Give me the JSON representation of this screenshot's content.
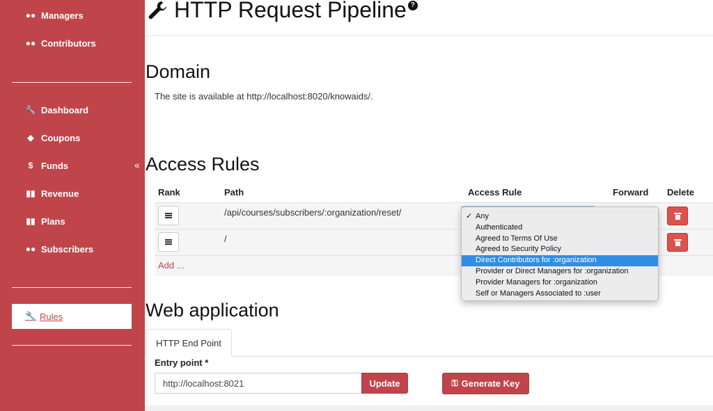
{
  "sidebar": {
    "top_items": [
      {
        "label": "Managers",
        "icon": "users-icon"
      },
      {
        "label": "Contributors",
        "icon": "users-icon"
      }
    ],
    "mid_items": [
      {
        "label": "Dashboard",
        "icon": "wrench-icon"
      },
      {
        "label": "Coupons",
        "icon": "tag-icon"
      },
      {
        "label": "Funds",
        "icon": "dollar-icon"
      },
      {
        "label": "Revenue",
        "icon": "bar-chart-icon"
      },
      {
        "label": "Plans",
        "icon": "bar-chart-icon"
      },
      {
        "label": "Subscribers",
        "icon": "users-icon"
      }
    ],
    "active_item": {
      "label": "Rules",
      "icon": "wrench-icon"
    },
    "collapse_glyph": "«"
  },
  "header": {
    "title": "HTTP Request Pipeline",
    "help_glyph": "?"
  },
  "domain": {
    "heading": "Domain",
    "text": "The site is available at http://localhost:8020/knowaids/."
  },
  "access_rules": {
    "heading": "Access Rules",
    "columns": {
      "rank": "Rank",
      "path": "Path",
      "rule": "Access Rule",
      "forward": "Forward",
      "delete": "Delete"
    },
    "rows": [
      {
        "path": "/api/courses/subscribers/:organization/reset/"
      },
      {
        "path": "/"
      }
    ],
    "add_label": "Add ...",
    "dropdown": {
      "checked": "Any",
      "highlighted": "Direct Contributors for :organization",
      "options": [
        "Any",
        "Authenticated",
        "Agreed to Terms Of Use",
        "Agreed to Security Policy",
        "Direct Contributors for :organization",
        "Provider or Direct Managers for :organization",
        "Provider Managers for :organization",
        "Self or Managers Associated to :user"
      ]
    }
  },
  "web_application": {
    "heading": "Web application",
    "tab_label": "HTTP End Point",
    "entry_label": "Entry point *",
    "entry_value": "http://localhost:8021",
    "update_label": "Update",
    "generate_key_label": "Generate Key"
  },
  "colors": {
    "sidebar": "#c0454a",
    "danger": "#d9534f",
    "highlight": "#2f8ee6"
  }
}
